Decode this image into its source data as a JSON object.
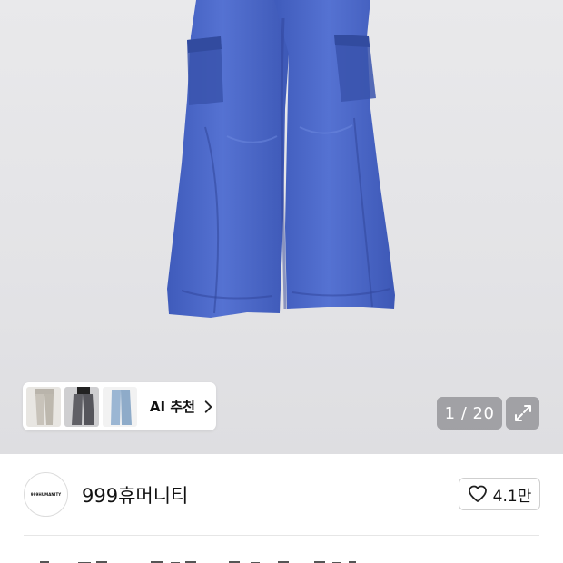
{
  "hero": {
    "image_subject": "blue-cargo-pants",
    "thumbnails": [
      {
        "name": "thumb-grey-pants"
      },
      {
        "name": "thumb-charcoal-pants"
      },
      {
        "name": "thumb-lightblue-pants"
      }
    ],
    "ai_label": "AI 추천",
    "counter": "1 / 20"
  },
  "seller": {
    "avatar_text": "999HUMANITY",
    "name": "999휴머니티",
    "likes": "4.1만"
  },
  "colors": {
    "pants_blue": "#4a66c6",
    "background": "#e6e6e9",
    "overlay": "#6e6e73"
  }
}
